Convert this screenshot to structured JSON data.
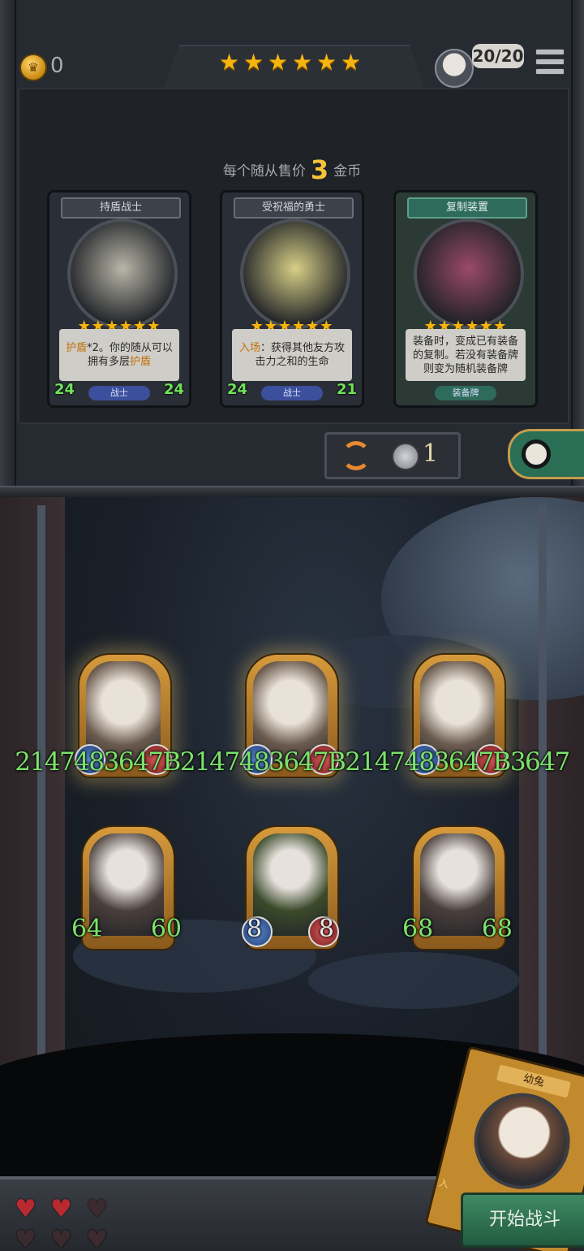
{
  "top_bar": {
    "gold": "0",
    "tavern_stars": 6,
    "star_glyph": "★",
    "player_counter": "20/20"
  },
  "shop": {
    "sell_prefix": "每个随从售价",
    "sell_price": "3",
    "sell_suffix": "金币",
    "cards": [
      {
        "title": "持盾战士",
        "stars": "★★★★★★",
        "description_parts": [
          "护盾",
          "*2。你的随从可以拥有多层",
          "护盾"
        ],
        "tribe": "战士",
        "attack": "24",
        "health": "24",
        "art_color": "#b9b6a8"
      },
      {
        "title": "受祝福的勇士",
        "stars": "★★★★★★",
        "description_parts": [
          "入场",
          "：获得其他友方攻击力之和的生命"
        ],
        "tribe": "战士",
        "attack": "24",
        "health": "21",
        "art_color": "#d8cf86"
      },
      {
        "title": "复制装置",
        "stars": "★★★★★★",
        "description": "装备时，变成已有装备的复制。若没有装备牌则变为随机装备牌",
        "tribe": "装备牌",
        "art_color": "#9a4a66"
      }
    ],
    "reroll_cost": "1"
  },
  "board": {
    "overflow_text": "2147483647B2147483647B2147483647B3647",
    "top_row": [
      {
        "name": "rabbit-minion-1",
        "art_color": "#6b5b4e"
      },
      {
        "name": "rabbit-minion-2",
        "art_color": "#6b5b4e"
      },
      {
        "name": "rabbit-minion-3",
        "art_color": "#6b5b4e"
      }
    ],
    "bottom_row": [
      {
        "attack": "64",
        "health": "60",
        "art_color": "#4a3f3b"
      },
      {
        "attack": "8",
        "health": "8",
        "art_color": "#3b4a2a"
      },
      {
        "attack": "68",
        "health": "68",
        "art_color": "#4a3f3b"
      }
    ]
  },
  "lives": {
    "full": 2,
    "empty": 4,
    "glyph": "♥"
  },
  "hand": {
    "card_title": "幼兔",
    "card_tag": "入"
  },
  "start_button": "开始战斗"
}
